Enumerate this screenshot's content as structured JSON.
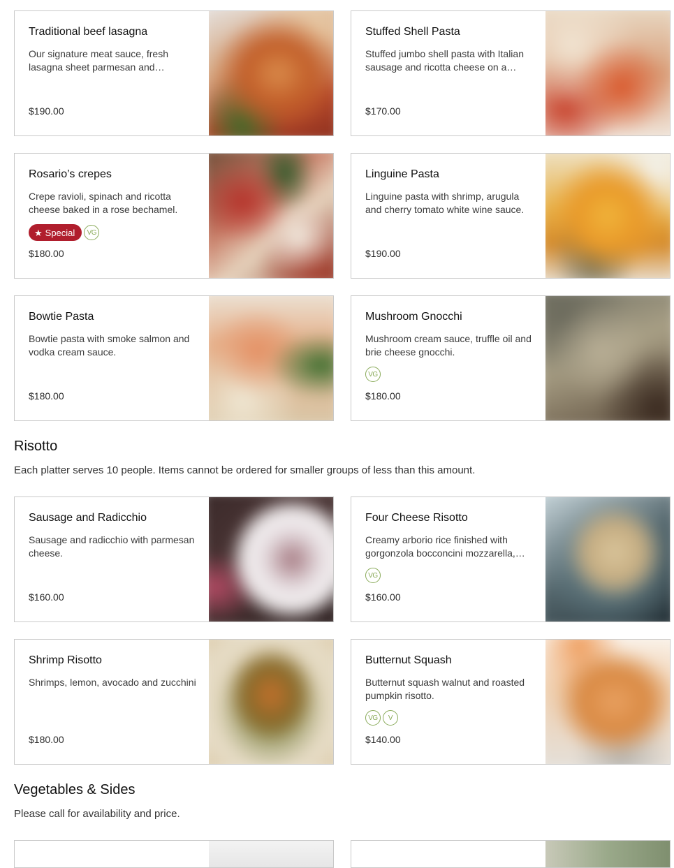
{
  "pasta_items": [
    {
      "title": "Traditional beef lasagna",
      "description": "Our signature meat sauce, fresh lasagna sheet parmesan and mozzarella cheese.",
      "price": "$190.00",
      "badges": [],
      "image": "lasagna-photo"
    },
    {
      "title": "Stuffed Shell Pasta",
      "description": "Stuffed jumbo shell pasta with Italian sausage and ricotta cheese on a tomato sauce.",
      "price": "$170.00",
      "badges": [],
      "image": "stuffed-shell-photo"
    },
    {
      "title": "Rosario’s crepes",
      "description": "Crepe ravioli, spinach and ricotta cheese baked in a rose bechamel.",
      "price": "$180.00",
      "special_label": "Special",
      "badges": [
        "VG"
      ],
      "image": "crepes-photo"
    },
    {
      "title": "Linguine Pasta",
      "description": "Linguine pasta with shrimp, arugula and cherry tomato white wine sauce.",
      "price": "$190.00",
      "badges": [],
      "image": "linguine-photo"
    },
    {
      "title": "Bowtie Pasta",
      "description": "Bowtie pasta with smoke salmon and vodka cream sauce.",
      "price": "$180.00",
      "badges": [],
      "image": "bowtie-photo"
    },
    {
      "title": "Mushroom Gnocchi",
      "description": "Mushroom cream sauce, truffle oil and brie cheese gnocchi.",
      "price": "$180.00",
      "badges": [
        "VG"
      ],
      "image": "gnocchi-photo"
    }
  ],
  "risotto_section": {
    "heading": "Risotto",
    "note": "Each platter serves 10 people. Items cannot be ordered for smaller groups of less than this amount.",
    "items": [
      {
        "title": "Sausage and Radicchio",
        "description": "Sausage and radicchio with parmesan cheese.",
        "price": "$160.00",
        "badges": [],
        "image": "sausage-radicchio-photo"
      },
      {
        "title": "Four Cheese Risotto",
        "description": "Creamy arborio rice finished with gorgonzola bocconcini mozzarella, and parmesan.",
        "price": "$160.00",
        "badges": [
          "VG"
        ],
        "image": "four-cheese-photo"
      },
      {
        "title": "Shrimp Risotto",
        "description": "Shrimps, lemon, avocado and zucchini",
        "price": "$180.00",
        "badges": [],
        "image": "shrimp-risotto-photo"
      },
      {
        "title": "Butternut Squash",
        "description": "Butternut squash walnut and roasted pumpkin risotto.",
        "price": "$140.00",
        "badges": [
          "VG",
          "V"
        ],
        "image": "butternut-photo"
      }
    ]
  },
  "vegetables_section": {
    "heading": "Vegetables & Sides",
    "note": "Please call for availability and price."
  },
  "colors": {
    "special_badge": "#b01e2d",
    "diet_badge": "#8aab5a",
    "card_border": "#c9c9c9"
  }
}
